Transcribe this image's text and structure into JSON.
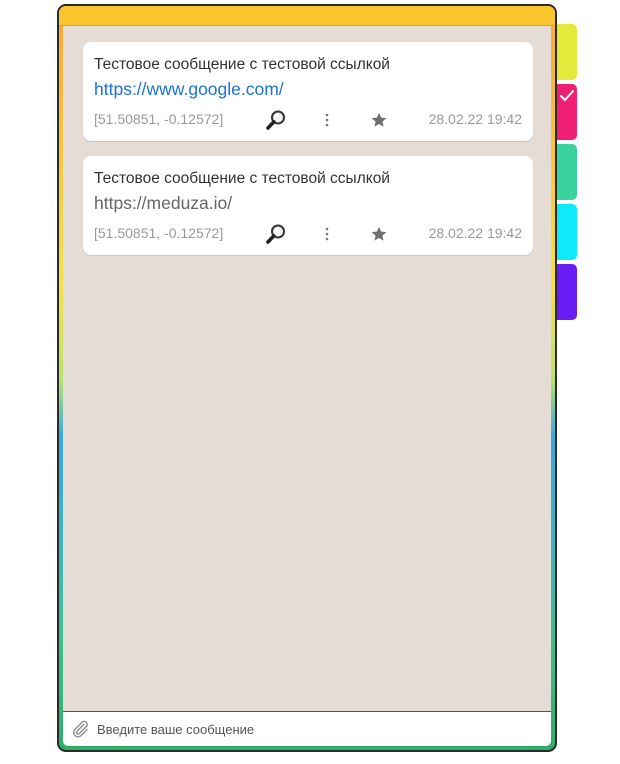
{
  "messages": [
    {
      "text": "Тестовое сообщение с тестовой ссылкой",
      "link": "https://www.google.com/",
      "link_color": "#1a73d9",
      "coords": "[51.50851, -0.12572]",
      "timestamp": "28.02.22 19:42",
      "icons": [
        "magnifier-icon",
        "more-vertical-icon",
        "star-icon"
      ]
    },
    {
      "text": "Тестовое сообщение с тестовой ссылкой",
      "link": "https://meduza.io/",
      "link_color": "#666666",
      "coords": "[51.50851, -0.12572]",
      "timestamp": "28.02.22 19:42",
      "icons": [
        "magnifier-icon",
        "more-vertical-icon",
        "star-icon"
      ]
    }
  ],
  "composer": {
    "placeholder": "Введите ваше сообщение",
    "icon": "paperclip-icon"
  },
  "color_tabs": [
    {
      "color": "#e3ea3c",
      "selected": false
    },
    {
      "color": "#ef1f73",
      "selected": true
    },
    {
      "color": "#3ad3a0",
      "selected": false
    },
    {
      "color": "#0ee9fb",
      "selected": false
    },
    {
      "color": "#6a1cf5",
      "selected": false
    }
  ],
  "theme": {
    "top_band": "#fbc52d",
    "chat_background": "#e5ddd5"
  }
}
